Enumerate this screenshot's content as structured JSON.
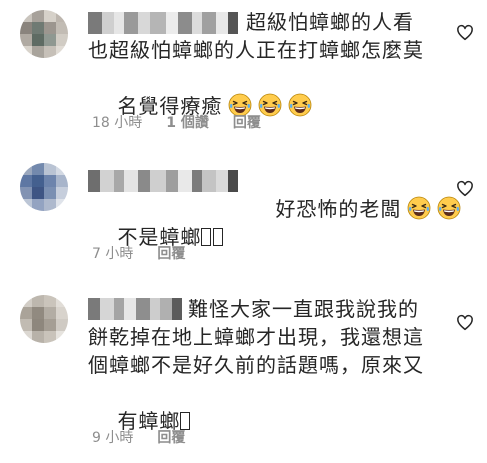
{
  "comments": [
    {
      "text_lines": [
        "超級怕蟑螂的人看",
        "也超級怕蟑螂的人正在打蟑螂怎麼莫",
        "名覺得療癒"
      ],
      "emoji_count": 3,
      "time": "18 小時",
      "likes": "1 個讚",
      "reply": "回覆"
    },
    {
      "text_lines": [
        "好恐怖的老闆",
        "不是蟑螂"
      ],
      "emoji_count": 2,
      "tofu_count": 2,
      "time": "7 小時",
      "reply": "回覆"
    },
    {
      "text_lines": [
        "難怪大家一直跟我說我的",
        "餅乾掉在地上蟑螂才出現，我還想這",
        "個蟑螂不是好久前的話題嗎，原來又",
        "有蟑螂"
      ],
      "tofu_count": 1,
      "time": "9 小時",
      "reply": "回覆"
    }
  ],
  "icons": {
    "like": "heart-outline-icon",
    "emoji": "grinning-squinting-face-icon"
  },
  "colors": {
    "text": "#262626",
    "meta": "#8e8e8e",
    "background": "#ffffff",
    "emoji_face": "#FFCC4D"
  }
}
